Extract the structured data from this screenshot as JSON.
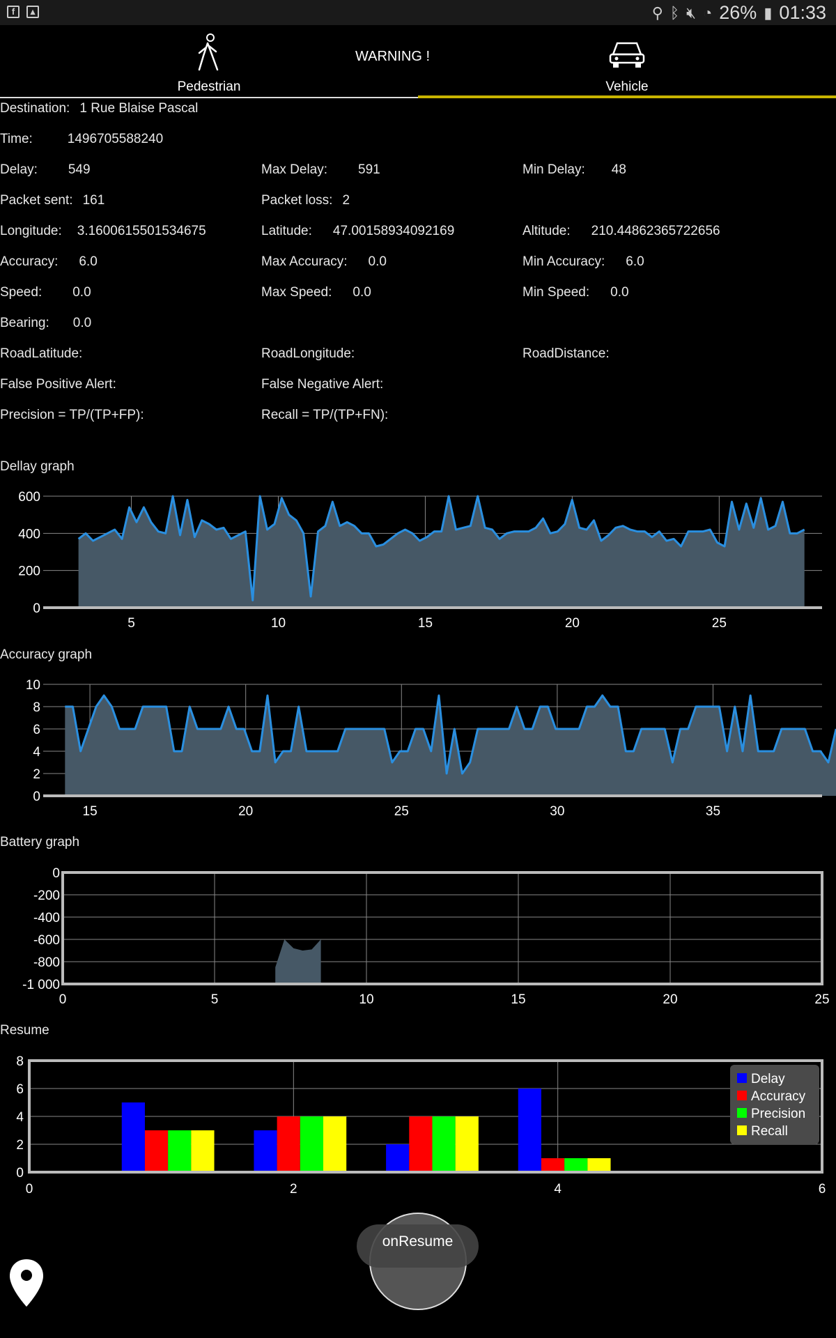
{
  "status_bar": {
    "battery": "26%",
    "time": "01:33",
    "icons": [
      "facebook-icon",
      "gallery-icon",
      "location-icon",
      "bluetooth-icon",
      "mute-icon",
      "wifi-icon",
      "battery-icon"
    ]
  },
  "tabs": [
    {
      "label": "Pedestrian",
      "icon": "pedestrian-icon",
      "active": false
    },
    {
      "label": "Vehicle",
      "icon": "car-icon",
      "active": true
    }
  ],
  "warning": "WARNING !",
  "info": {
    "destination": {
      "label": "Destination:",
      "value": "1 Rue Blaise Pascal"
    },
    "time": {
      "label": "Time:",
      "value": "1496705588240"
    },
    "delay": {
      "label": "Delay:",
      "value": "549"
    },
    "max_delay": {
      "label": "Max Delay:",
      "value": "591"
    },
    "min_delay": {
      "label": "Min Delay:",
      "value": "48"
    },
    "packet_sent": {
      "label": "Packet sent:",
      "value": "161"
    },
    "packet_loss": {
      "label": "Packet loss:",
      "value": "2"
    },
    "longitude": {
      "label": "Longitude:",
      "value": "3.1600615501534675"
    },
    "latitude": {
      "label": "Latitude:",
      "value": "47.00158934092169"
    },
    "altitude": {
      "label": "Altitude:",
      "value": "210.44862365722656"
    },
    "accuracy": {
      "label": "Accuracy:",
      "value": "6.0"
    },
    "max_accuracy": {
      "label": "Max Accuracy:",
      "value": "0.0"
    },
    "min_accuracy": {
      "label": "Min Accuracy:",
      "value": "6.0"
    },
    "speed": {
      "label": "Speed:",
      "value": "0.0"
    },
    "max_speed": {
      "label": "Max Speed:",
      "value": "0.0"
    },
    "min_speed": {
      "label": "Min Speed:",
      "value": "0.0"
    },
    "bearing": {
      "label": "Bearing:",
      "value": "0.0"
    },
    "road_latitude": {
      "label": "RoadLatitude:",
      "value": ""
    },
    "road_longitude": {
      "label": "RoadLongitude:",
      "value": ""
    },
    "road_distance": {
      "label": "RoadDistance:",
      "value": ""
    },
    "false_positive": {
      "label": "False Positive Alert:",
      "value": ""
    },
    "false_negative": {
      "label": "False Negative Alert:",
      "value": ""
    },
    "precision": {
      "label": "Precision = TP/(TP+FP):",
      "value": ""
    },
    "recall": {
      "label": "Recall = TP/(TP+FN):",
      "value": ""
    }
  },
  "chart_data": [
    {
      "id": "delay",
      "title": "Dellay graph",
      "type": "area",
      "xlim": [
        2.0,
        28.5
      ],
      "ylim": [
        0,
        600
      ],
      "xticks": [
        5,
        10,
        15,
        20,
        25
      ],
      "yticks": [
        0,
        200,
        400,
        600
      ],
      "x_start": 3.2,
      "x_step": 0.247,
      "values": [
        370,
        400,
        360,
        380,
        400,
        420,
        370,
        540,
        460,
        540,
        460,
        410,
        400,
        600,
        390,
        580,
        380,
        470,
        450,
        420,
        430,
        370,
        390,
        410,
        40,
        600,
        420,
        450,
        590,
        500,
        470,
        400,
        60,
        410,
        440,
        570,
        440,
        460,
        440,
        400,
        400,
        330,
        340,
        370,
        400,
        420,
        400,
        360,
        380,
        410,
        410,
        600,
        420,
        430,
        440,
        600,
        430,
        420,
        370,
        400,
        410,
        410,
        410,
        430,
        480,
        400,
        410,
        450,
        580,
        430,
        420,
        470,
        360,
        390,
        430,
        440,
        420,
        410,
        410,
        380,
        410,
        360,
        370,
        330,
        410,
        410,
        410,
        420,
        350,
        330,
        570,
        420,
        560,
        430,
        590,
        420,
        440,
        570,
        400,
        400,
        420
      ]
    },
    {
      "id": "accuracy",
      "title": "Accuracy graph",
      "type": "area",
      "xlim": [
        13.5,
        38.5
      ],
      "ylim": [
        0,
        10
      ],
      "xticks": [
        15,
        20,
        25,
        30,
        35
      ],
      "yticks": [
        0,
        2,
        4,
        6,
        8,
        10
      ],
      "x_start": 14.2,
      "x_step": 0.25,
      "values": [
        8,
        8,
        4,
        6,
        8,
        9,
        8,
        6,
        6,
        6,
        8,
        8,
        8,
        8,
        4,
        4,
        8,
        6,
        6,
        6,
        6,
        8,
        6,
        6,
        4,
        4,
        9,
        3,
        4,
        4,
        8,
        4,
        4,
        4,
        4,
        4,
        6,
        6,
        6,
        6,
        6,
        6,
        3,
        4,
        4,
        6,
        6,
        4,
        9,
        2,
        6,
        2,
        3,
        6,
        6,
        6,
        6,
        6,
        8,
        6,
        6,
        8,
        8,
        6,
        6,
        6,
        6,
        8,
        8,
        9,
        8,
        8,
        4,
        4,
        6,
        6,
        6,
        6,
        3,
        6,
        6,
        8,
        8,
        8,
        8,
        4,
        8,
        4,
        9,
        4,
        4,
        4,
        6,
        6,
        6,
        6,
        4,
        4,
        3,
        6
      ]
    },
    {
      "id": "battery",
      "title": "Battery graph",
      "type": "area",
      "xlim": [
        0,
        25
      ],
      "ylim": [
        -1000,
        0
      ],
      "xticks": [
        0,
        5,
        10,
        15,
        20,
        25
      ],
      "yticks": [
        0,
        -200,
        -400,
        -600,
        -800,
        -1000
      ],
      "ytick_labels": [
        "0",
        "-200",
        "-400",
        "-600",
        "-800",
        "-1 000"
      ],
      "x": [
        7.0,
        7.3,
        7.6,
        7.9,
        8.2,
        8.5
      ],
      "values": [
        -850,
        -600,
        -680,
        -700,
        -690,
        -600
      ]
    },
    {
      "id": "resume",
      "title": "Resume",
      "type": "bar",
      "xlim": [
        0,
        6
      ],
      "ylim": [
        0,
        8
      ],
      "xticks": [
        0,
        2,
        4,
        6
      ],
      "yticks": [
        0,
        2,
        4,
        6,
        8
      ],
      "groups_x": [
        0.7,
        1.7,
        2.7,
        3.7
      ],
      "bar_width": 0.175,
      "series": [
        {
          "name": "Delay",
          "color": "#0000ff",
          "values": [
            5,
            3,
            2,
            6
          ]
        },
        {
          "name": "Accuracy",
          "color": "#ff0000",
          "values": [
            3,
            4,
            4,
            1
          ]
        },
        {
          "name": "Precision",
          "color": "#00ff00",
          "values": [
            3,
            4,
            4,
            1
          ]
        },
        {
          "name": "Recall",
          "color": "#ffff00",
          "values": [
            3,
            4,
            4,
            1
          ]
        }
      ],
      "legend_position": "top-right"
    }
  ],
  "buttons": {
    "resume": "onResume"
  }
}
